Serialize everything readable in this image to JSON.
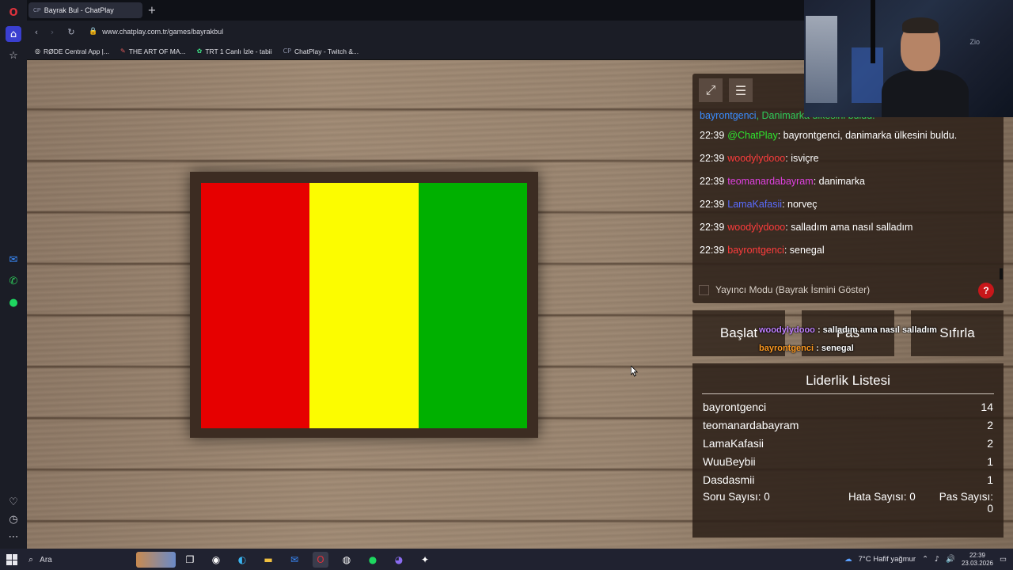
{
  "browser": {
    "tab_title": "Bayrak Bul - ChatPlay",
    "tab_favicon": "CP",
    "new_tab": "+",
    "url": "www.chatplay.com.tr/games/bayrakbul",
    "bookmarks": [
      {
        "label": "RØDE Central App |...",
        "icon": "rode-icon"
      },
      {
        "label": "THE ART OF MA...",
        "icon": "bookmark-icon"
      },
      {
        "label": "TRT 1 Canlı İzle - tabii",
        "icon": "trt-icon"
      },
      {
        "label": "ChatPlay - Twitch &...",
        "icon": "chatplay-icon"
      }
    ]
  },
  "flag": {
    "bands": [
      "#e60000",
      "#fcfc00",
      "#00b000"
    ]
  },
  "chat": {
    "first_line": {
      "user": "bayrontgenci",
      "text": ", Danimarka ülkesini buldu."
    },
    "messages": [
      {
        "time": "22:39",
        "user": "@ChatPlay",
        "color": "#2ee62e",
        "text": ": bayrontgenci, danimarka ülkesini buldu."
      },
      {
        "time": "22:39",
        "user": "woodylydooo",
        "color": "#ff3c3c",
        "text": ": isviçre"
      },
      {
        "time": "22:39",
        "user": "teomanardabayram",
        "color": "#e040e0",
        "text": ": danimarka"
      },
      {
        "time": "22:39",
        "user": "LamaKafasii",
        "color": "#5a6cff",
        "text": ": norveç"
      },
      {
        "time": "22:39",
        "user": "woodylydooo",
        "color": "#ff3c3c",
        "text": ": salladım ama nasıl salladım"
      },
      {
        "time": "22:39",
        "user": "bayrontgenci",
        "color": "#ff3c3c",
        "text": ": senegal"
      }
    ],
    "streamer_mode_label": "Yayıncı Modu (Bayrak İsmini Göster)",
    "help": "?"
  },
  "controls": {
    "start": "Başlat",
    "pass": "Pas",
    "reset": "Sıfırla"
  },
  "overlay": [
    {
      "user": "woodylydooo",
      "color": "#c080ff",
      "text": " : salladım ama nasıl salladım"
    },
    {
      "user": "bayrontgenci",
      "color": "#ff9a20",
      "text": " : senegal"
    }
  ],
  "leaderboard": {
    "title": "Liderlik Listesi",
    "rows": [
      {
        "name": "bayrontgenci",
        "score": "14"
      },
      {
        "name": "teomanardabayram",
        "score": "2"
      },
      {
        "name": "LamaKafasii",
        "score": "2"
      },
      {
        "name": "WuuBeybii",
        "score": "1"
      },
      {
        "name": "Dasdasmii",
        "score": "1"
      }
    ],
    "stats": {
      "questions": "Soru Sayısı: 0",
      "errors": "Hata Sayısı: 0",
      "passes": "Pas Sayısı: 0"
    }
  },
  "webcam": {
    "logo_text": "Zio"
  },
  "taskbar": {
    "search_label": "Ara",
    "weather": "7°C  Hafif yağmur",
    "time": "22:39",
    "date": "23.03.2026"
  }
}
